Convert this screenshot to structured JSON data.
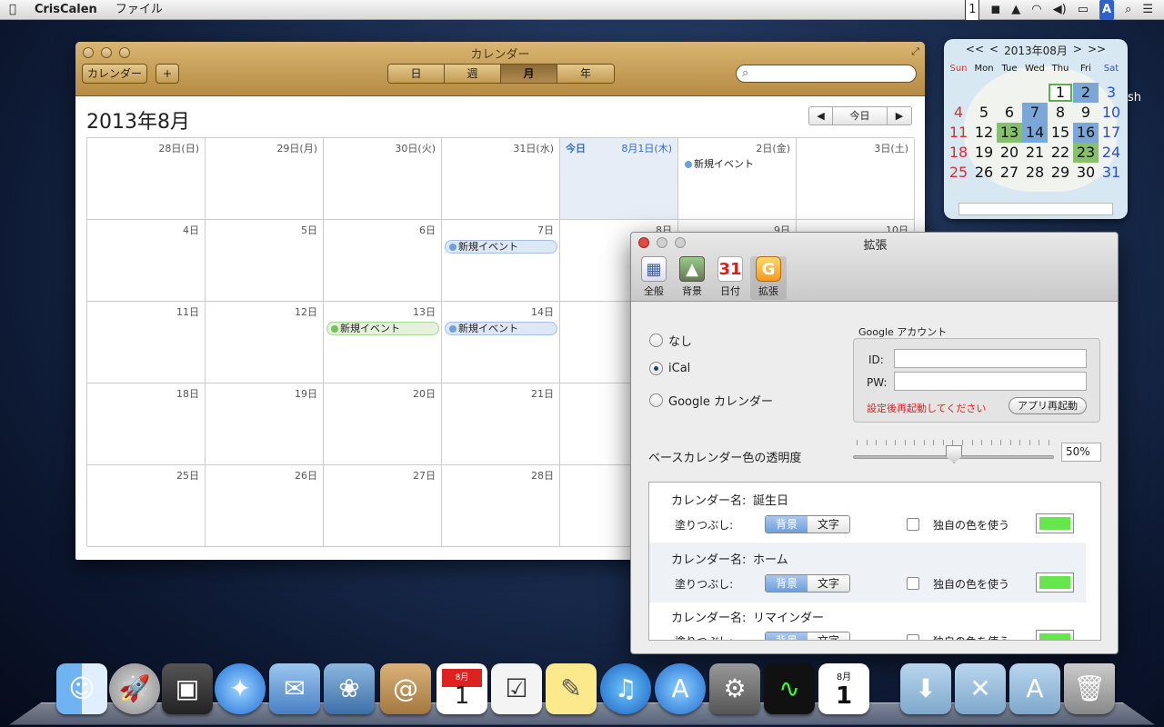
{
  "menubar": {
    "apple": "",
    "app_name": "CrisCalen",
    "menu_file": "ファイル",
    "input_indicator": "1",
    "input_method": "A"
  },
  "calendar": {
    "window_title": "カレンダー",
    "calendars_button": "カレンダー",
    "add_button": "+",
    "views": [
      "日",
      "週",
      "月",
      "年"
    ],
    "active_view": "月",
    "month_title": "2013年8月",
    "today_button": "今日",
    "prev": "◀",
    "next": "▶",
    "today_label": "今日",
    "rows": [
      [
        "28日(日)",
        "29日(月)",
        "30日(火)",
        "31日(水)",
        "8月1日(木)",
        "2日(金)",
        "3日(土)"
      ],
      [
        "4日",
        "5日",
        "6日",
        "7日",
        "8日",
        "9日",
        "10日"
      ],
      [
        "11日",
        "12日",
        "13日",
        "14日",
        "",
        "",
        ""
      ],
      [
        "18日",
        "19日",
        "20日",
        "21日",
        "",
        "",
        ""
      ],
      [
        "25日",
        "26日",
        "27日",
        "28日",
        "",
        "",
        ""
      ]
    ],
    "event_label": "新規イベント"
  },
  "widget": {
    "nav_first": "<<",
    "nav_prev": "<",
    "month": "2013年08月",
    "nav_next": ">",
    "nav_last": ">>",
    "weekdays": [
      "Sun",
      "Mon",
      "Tue",
      "Wed",
      "Thu",
      "Fri",
      "Sat"
    ],
    "weeks": [
      [
        "",
        "",
        "",
        "",
        "1",
        "2",
        "3"
      ],
      [
        "4",
        "5",
        "6",
        "7",
        "8",
        "9",
        "10"
      ],
      [
        "11",
        "12",
        "13",
        "14",
        "15",
        "16",
        "17"
      ],
      [
        "18",
        "19",
        "20",
        "21",
        "22",
        "23",
        "24"
      ],
      [
        "25",
        "26",
        "27",
        "28",
        "29",
        "30",
        "31"
      ]
    ],
    "right_text": "sh"
  },
  "prefs": {
    "title": "拡張",
    "tabs": [
      {
        "label": "全般",
        "icon": "calendar-icon"
      },
      {
        "label": "背景",
        "icon": "landscape-icon"
      },
      {
        "label": "日付",
        "icon": "date31-icon",
        "glyph": "31"
      },
      {
        "label": "拡張",
        "icon": "g-icon",
        "glyph": "G"
      }
    ],
    "radio_none": "なし",
    "radio_ical": "iCal",
    "radio_google": "Google カレンダー",
    "google_group": "Google アカウント",
    "id_label": "ID:",
    "pw_label": "PW:",
    "restart_note": "設定後再起動してください",
    "restart_button": "アプリ再起動",
    "opacity_label": "ベースカレンダー色の透明度",
    "opacity_value": "50%",
    "opacity": 0.5,
    "calendars": [
      {
        "name_label": "カレンダー名:",
        "name": "誕生日",
        "fill_label": "塗りつぶし:",
        "bg": "背景",
        "text": "文字",
        "own_color": "独自の色を使う",
        "color": "#66e64d"
      },
      {
        "name_label": "カレンダー名:",
        "name": "ホーム",
        "fill_label": "塗りつぶし:",
        "bg": "背景",
        "text": "文字",
        "own_color": "独自の色を使う",
        "color": "#66e64d"
      },
      {
        "name_label": "カレンダー名:",
        "name": "リマインダー",
        "fill_label": "塗りつぶし:",
        "bg": "背景",
        "text": "文字",
        "own_color": "独自の色を使う",
        "color": "#66e64d"
      }
    ]
  },
  "dock": {
    "items": [
      "finder-icon",
      "launchpad-icon",
      "photobooth-icon",
      "safari-icon",
      "mail-icon",
      "iphoto-icon",
      "addressbook-icon",
      "ical-icon",
      "reminders-icon",
      "stickies-icon",
      "itunes-icon",
      "appstore-icon",
      "system-preferences-icon",
      "activity-monitor-icon",
      "criscalen-icon",
      "downloads-folder-icon",
      "utilities-folder-icon",
      "applications-folder-icon",
      "trash-icon"
    ],
    "ical_month": "8月",
    "ical_day": "1"
  }
}
